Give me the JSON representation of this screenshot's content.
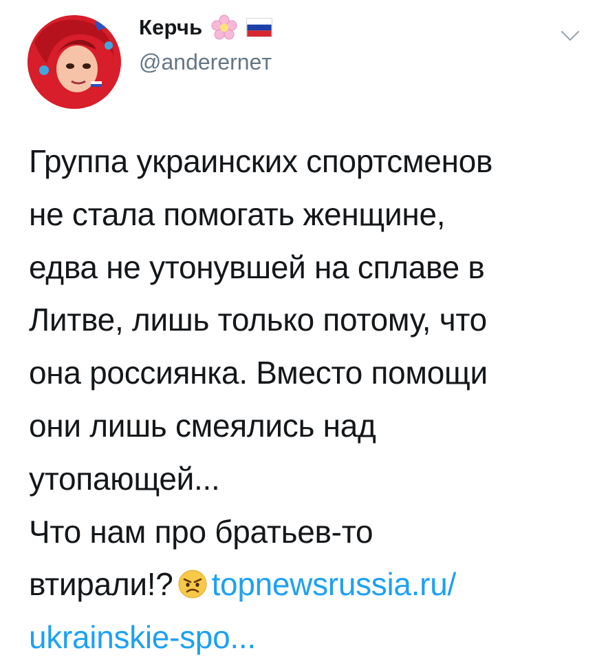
{
  "author": {
    "name": "Керчь",
    "handle": "@andererneт",
    "avatar_icon": "avatar-image",
    "badges": [
      "flower-icon",
      "russian-flag-icon"
    ]
  },
  "menu_icon": "chevron-down-icon",
  "tweet": {
    "lines": [
      "Группа украинских спортсменов",
      "не стала помогать женщине,",
      "едва не утонувшей на сплаве в",
      "Литве, лишь только потому, что",
      "она россиянка. Вместо помощи",
      "они лишь смеялись над",
      "утопающей...",
      "Что нам про братьев-то"
    ],
    "last_line_text": "втирали!?",
    "emoji": "angry-face-emoji",
    "link_part1": "topnewsrussia.ru/",
    "link_part2": "ukrainskie-spo..."
  },
  "colors": {
    "text": "#14171a",
    "secondary": "#657786",
    "link": "#1da1f2"
  }
}
